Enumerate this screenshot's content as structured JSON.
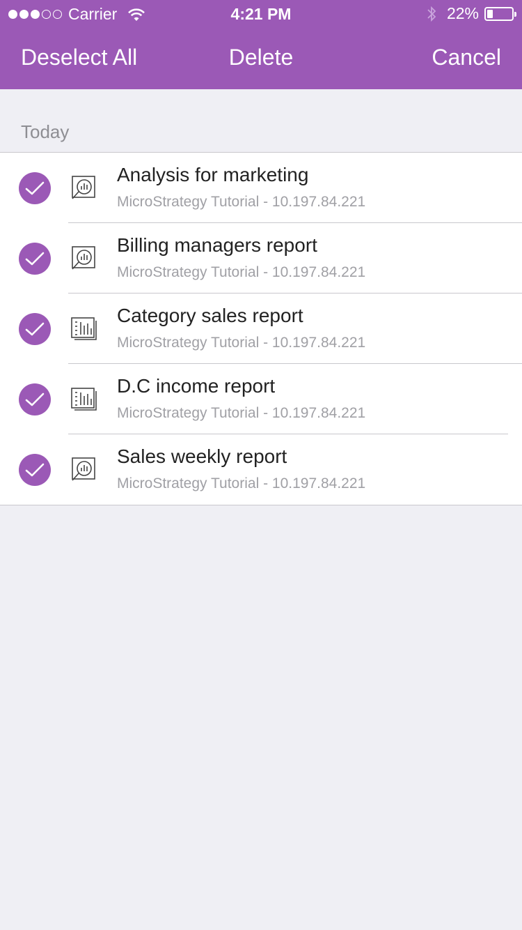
{
  "status_bar": {
    "carrier": "Carrier",
    "time": "4:21 PM",
    "battery": "22%",
    "signal_icon": "signal-dots-icon",
    "wifi_icon": "wifi-icon",
    "bluetooth_icon": "bluetooth-icon"
  },
  "navbar": {
    "left": "Deselect All",
    "center": "Delete",
    "right": "Cancel"
  },
  "section": {
    "title": "Today"
  },
  "items": [
    {
      "title": "Analysis for marketing",
      "subtitle": "MicroStrategy Tutorial - 10.197.84.221",
      "icon": "dashboard-report-icon",
      "selected": true
    },
    {
      "title": "Billing managers report",
      "subtitle": "MicroStrategy Tutorial - 10.197.84.221",
      "icon": "dashboard-report-icon",
      "selected": true
    },
    {
      "title": "Category sales report",
      "subtitle": "MicroStrategy Tutorial - 10.197.84.221",
      "icon": "grid-report-icon",
      "selected": true
    },
    {
      "title": "D.C income report",
      "subtitle": "MicroStrategy Tutorial - 10.197.84.221",
      "icon": "grid-report-icon",
      "selected": true
    },
    {
      "title": "Sales weekly report",
      "subtitle": "MicroStrategy Tutorial - 10.197.84.221",
      "icon": "dashboard-report-icon",
      "selected": true
    }
  ],
  "colors": {
    "accent": "#9b59b6",
    "background": "#efeff4"
  }
}
